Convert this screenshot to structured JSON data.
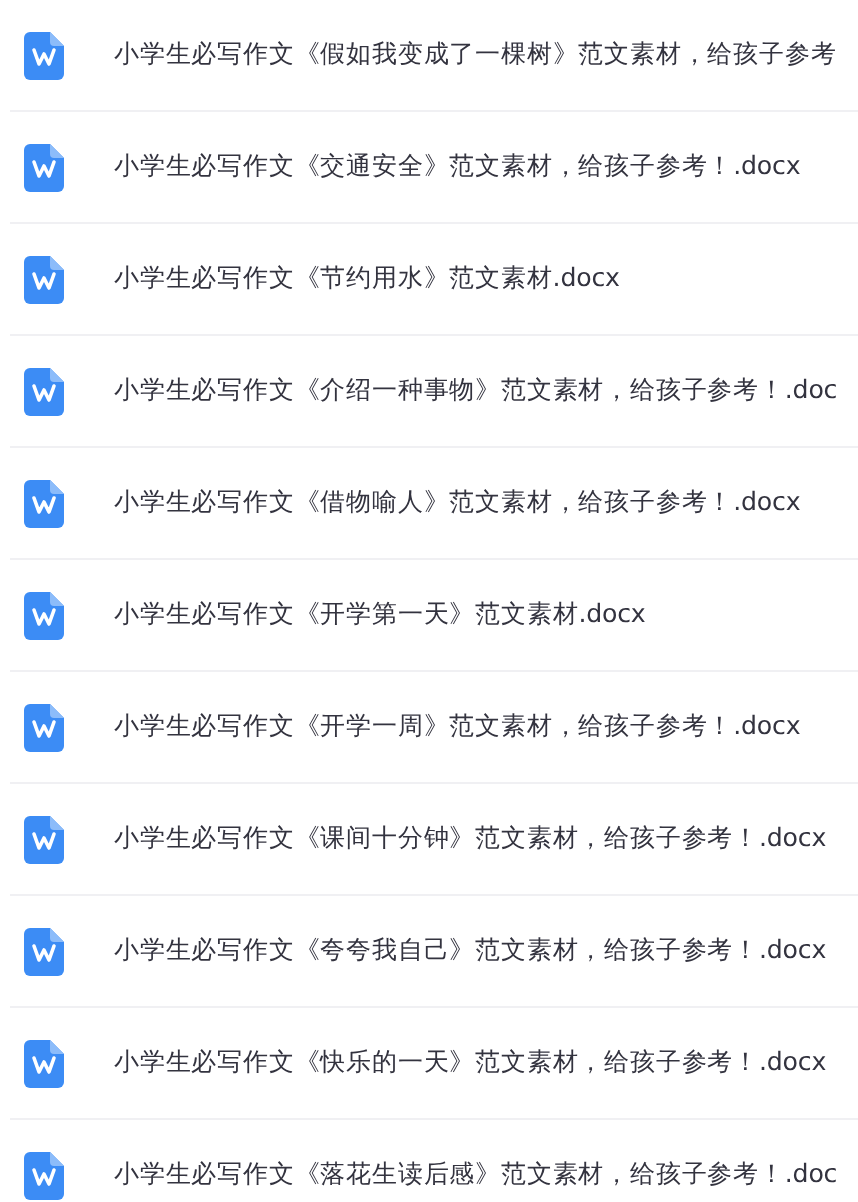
{
  "files": [
    {
      "name": "小学生必写作文《假如我变成了一棵树》范文素材，给孩子参考"
    },
    {
      "name": "小学生必写作文《交通安全》范文素材，给孩子参考！.docx"
    },
    {
      "name": "小学生必写作文《节约用水》范文素材.docx"
    },
    {
      "name": "小学生必写作文《介绍一种事物》范文素材，给孩子参考！.doc"
    },
    {
      "name": "小学生必写作文《借物喻人》范文素材，给孩子参考！.docx"
    },
    {
      "name": "小学生必写作文《开学第一天》范文素材.docx"
    },
    {
      "name": "小学生必写作文《开学一周》范文素材，给孩子参考！.docx"
    },
    {
      "name": "小学生必写作文《课间十分钟》范文素材，给孩子参考！.docx"
    },
    {
      "name": "小学生必写作文《夸夸我自己》范文素材，给孩子参考！.docx"
    },
    {
      "name": "小学生必写作文《快乐的一天》范文素材，给孩子参考！.docx"
    },
    {
      "name": "小学生必写作文《落花生读后感》范文素材，给孩子参考！.doc"
    }
  ]
}
